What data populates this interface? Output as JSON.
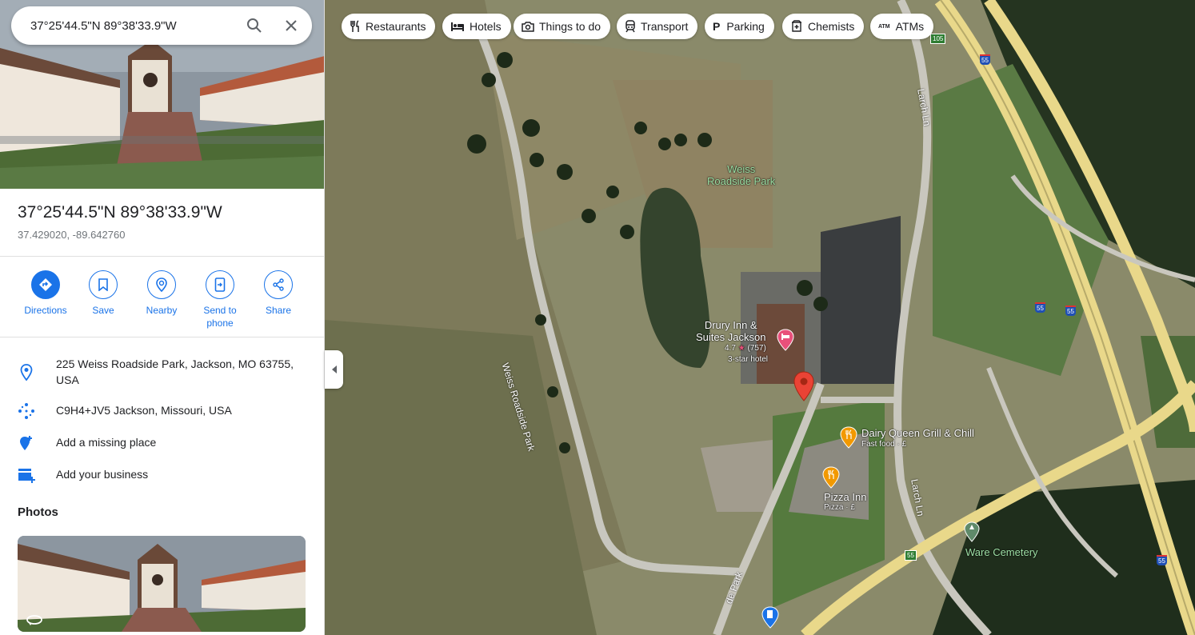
{
  "search": {
    "value": "37°25'44.5\"N 89°38'33.9\"W"
  },
  "place": {
    "title": "37°25'44.5\"N 89°38'33.9\"W",
    "decimal_coordinates": "37.429020, -89.642760"
  },
  "actions": [
    {
      "label": "Directions",
      "icon": "directions-icon"
    },
    {
      "label": "Save",
      "icon": "bookmark-icon"
    },
    {
      "label": "Nearby",
      "icon": "nearby-icon"
    },
    {
      "label": "Send to phone",
      "icon": "send-to-phone-icon"
    },
    {
      "label": "Share",
      "icon": "share-icon"
    }
  ],
  "info": {
    "address": "225 Weiss Roadside Park, Jackson, MO 63755, USA",
    "plus_code": "C9H4+JV5 Jackson, Missouri, USA",
    "add_missing_place": "Add a missing place",
    "add_business": "Add your business"
  },
  "photos": {
    "title": "Photos"
  },
  "chips": [
    {
      "label": "Restaurants",
      "icon": "fork-knife-icon"
    },
    {
      "label": "Hotels",
      "icon": "bed-icon"
    },
    {
      "label": "Things to do",
      "icon": "camera-icon"
    },
    {
      "label": "Transport",
      "icon": "train-icon"
    },
    {
      "label": "Parking",
      "icon": "parking-icon"
    },
    {
      "label": "Chemists",
      "icon": "pharmacy-icon"
    },
    {
      "label": "ATMs",
      "icon": "atm-icon"
    }
  ],
  "map": {
    "park": {
      "name_line1": "Weiss",
      "name_line2": "Roadside Park"
    },
    "hotel": {
      "name_line1": "Drury Inn &",
      "name_line2": "Suites Jackson",
      "rating": "4.7",
      "reviews": "(757)",
      "category": "3-star hotel"
    },
    "dairy_queen": {
      "name": "Dairy Queen Grill & Chill",
      "category": "Fast food · £"
    },
    "pizza_inn": {
      "name": "Pizza Inn",
      "category": "Pizza · £"
    },
    "cemetery": {
      "name": "Ware Cemetery"
    },
    "roads": {
      "weiss_roadside_park": "Weiss Roadside Park",
      "larch_ln_top": "Larch Ln",
      "larch_ln_bottom": "Larch Ln",
      "park_bottom": "de Park"
    },
    "shields": {
      "interstate_55": "55",
      "route_105": "105",
      "route_55": "55"
    }
  },
  "colors": {
    "accent": "#1a73e8",
    "pin_red": "#ea4335",
    "hotel_pink": "#e8507a",
    "food_orange": "#f29900"
  }
}
